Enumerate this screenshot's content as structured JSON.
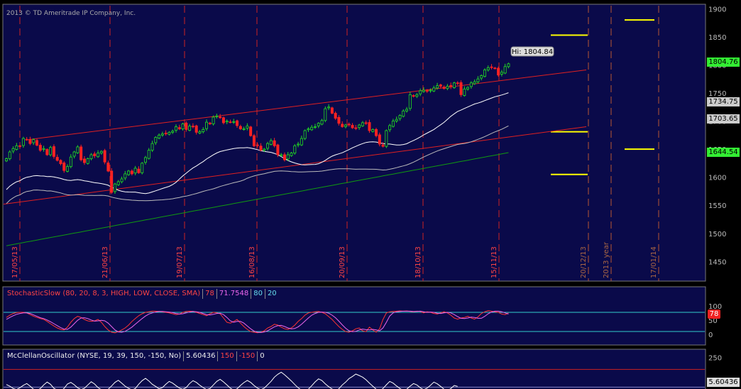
{
  "copyright": "2013 © TD Ameritrade IP Company, Inc.",
  "colors": {
    "panel_bg": "#0a0a4a",
    "up_candle": "#22dd22",
    "down_candle": "#ff2222",
    "channel": "#e02020",
    "ma_short": "#ffffff",
    "ma_mid": "#bbbbbb",
    "ma_long": "#119911",
    "yellow_levels": "#ffff00",
    "price_badge": "#33ee33",
    "stoch_k": "#ff3333",
    "stoch_d": "#ee66ee",
    "osc_line": "#ffffff"
  },
  "chart_data": [
    {
      "type": "candlestick",
      "title": "",
      "ylim": [
        1415,
        1908
      ],
      "y_ticks": [
        "1900",
        "1850",
        "1800",
        "1750",
        "1700",
        "1650",
        "1600",
        "1550",
        "1500",
        "1450"
      ],
      "x_date_labels": [
        "17/05/13",
        "21/06/13",
        "19/07/13",
        "16/08/13",
        "20/09/13",
        "18/10/13",
        "15/11/13",
        "20/12/13",
        "2013 year",
        "17/01/14"
      ],
      "hi_label": "Hi: 1804.84",
      "price_badges": [
        {
          "value": "1804.76",
          "y": 1804.76,
          "style": "green"
        },
        {
          "value": "1734.75",
          "y": 1734.75,
          "style": "gray"
        },
        {
          "value": "1703.65",
          "y": 1703.65,
          "style": "gray"
        },
        {
          "value": "1644.54",
          "y": 1644.54,
          "style": "green"
        }
      ],
      "closes": [
        1633,
        1645,
        1651,
        1656,
        1655,
        1669,
        1667,
        1660,
        1667,
        1657,
        1648,
        1651,
        1640,
        1653,
        1637,
        1630,
        1624,
        1612,
        1619,
        1636,
        1645,
        1654,
        1631,
        1626,
        1633,
        1640,
        1638,
        1643,
        1646,
        1627,
        1611,
        1573,
        1588,
        1592,
        1597,
        1606,
        1611,
        1606,
        1616,
        1608,
        1625,
        1635,
        1648,
        1660,
        1671,
        1675,
        1677,
        1678,
        1680,
        1682,
        1690,
        1686,
        1695,
        1685,
        1691,
        1690,
        1680,
        1681,
        1685,
        1698,
        1695,
        1707,
        1709,
        1706,
        1697,
        1700,
        1698,
        1699,
        1692,
        1686,
        1686,
        1691,
        1674,
        1656,
        1657,
        1648,
        1650,
        1660,
        1665,
        1656,
        1640,
        1640,
        1631,
        1640,
        1643,
        1656,
        1659,
        1669,
        1683,
        1686,
        1689,
        1690,
        1696,
        1701,
        1722,
        1725,
        1714,
        1705,
        1696,
        1690,
        1693,
        1694,
        1688,
        1687,
        1693,
        1697,
        1696,
        1683,
        1685,
        1674,
        1659,
        1655,
        1683,
        1692,
        1700,
        1703,
        1710,
        1718,
        1721,
        1747,
        1744,
        1747,
        1754,
        1755,
        1753,
        1755,
        1759,
        1763,
        1762,
        1758,
        1762,
        1761,
        1768,
        1767,
        1747,
        1757,
        1760,
        1768,
        1770,
        1775,
        1781,
        1791,
        1795,
        1796,
        1794,
        1782,
        1787,
        1797,
        1802
      ]
    },
    {
      "type": "line",
      "legend_items": [
        "StochasticSlow (80, 20, 8, 3, HIGH, LOW, CLOSE, SMA)",
        "78",
        "71.7548",
        "80",
        "20"
      ],
      "ylim": [
        0,
        100
      ],
      "y_ticks": [
        "100",
        "50",
        "0"
      ],
      "overbought": 80,
      "oversold": 20,
      "current_badge": "78",
      "current_value": 78,
      "series": [
        {
          "values": [
            62,
            70,
            76,
            79,
            80,
            80,
            78,
            72,
            66,
            62,
            58,
            55,
            48,
            40,
            32,
            25,
            20,
            18,
            28,
            45,
            58,
            66,
            62,
            55,
            50,
            48,
            50,
            55,
            45,
            30,
            18,
            10,
            8,
            12,
            18,
            25,
            35,
            48,
            58,
            68,
            75,
            80,
            82,
            84,
            84,
            83,
            82,
            80,
            78,
            75,
            72,
            74,
            80,
            83,
            84,
            83,
            80,
            76,
            72,
            68,
            75,
            80,
            78,
            75,
            60,
            45,
            42,
            48,
            55,
            42,
            30,
            20,
            12,
            10,
            8,
            10,
            15,
            25,
            30,
            38,
            35,
            28,
            22,
            20,
            25,
            35,
            48,
            58,
            70,
            78,
            80,
            82,
            83,
            80,
            75,
            65,
            55,
            42,
            30,
            20,
            12,
            10,
            15,
            22,
            25,
            15,
            12,
            28,
            18,
            10,
            22,
            55,
            78,
            82,
            83,
            84,
            85,
            84,
            85,
            83,
            82,
            84,
            83,
            78,
            82,
            80,
            76,
            74,
            78,
            82,
            78,
            70,
            60,
            56,
            60,
            62,
            66,
            60,
            56,
            64,
            76,
            82,
            86,
            84,
            82,
            80,
            74,
            72,
            78
          ]
        },
        {
          "values": [
            55,
            62,
            68,
            73,
            76,
            78,
            78,
            76,
            71,
            66,
            61,
            58,
            53,
            47,
            40,
            33,
            26,
            21,
            20,
            28,
            40,
            52,
            60,
            61,
            58,
            53,
            49,
            50,
            52,
            50,
            42,
            30,
            18,
            11,
            10,
            13,
            20,
            28,
            38,
            48,
            58,
            67,
            74,
            78,
            81,
            83,
            83,
            82,
            81,
            79,
            76,
            74,
            75,
            78,
            81,
            83,
            82,
            80,
            76,
            72,
            71,
            73,
            76,
            77,
            72,
            62,
            50,
            45,
            48,
            48,
            42,
            32,
            22,
            14,
            10,
            9,
            11,
            15,
            22,
            29,
            33,
            34,
            30,
            25,
            22,
            23,
            29,
            38,
            49,
            60,
            70,
            76,
            80,
            81,
            80,
            77,
            70,
            61,
            49,
            36,
            24,
            15,
            12,
            13,
            18,
            21,
            19,
            18,
            20,
            18,
            15,
            25,
            45,
            67,
            78,
            82,
            83,
            84,
            84,
            84,
            83,
            83,
            84,
            82,
            80,
            81,
            80,
            77,
            76,
            78,
            80,
            78,
            72,
            65,
            59,
            58,
            60,
            63,
            62,
            59,
            59,
            66,
            75,
            81,
            84,
            84,
            82,
            78,
            74
          ]
        }
      ]
    },
    {
      "type": "line",
      "legend_items": [
        "McClellanOscillator (NYSE, 19, 39, 150, -150, No)",
        "5.60436",
        "150",
        "-150",
        "0"
      ],
      "ylim": [
        -40,
        320
      ],
      "y_ticks": [
        "250"
      ],
      "upper_level": 150,
      "zero_level": 0,
      "current_badge": "5.60436",
      "current_value": 5.60436,
      "series": [
        {
          "values": [
            22,
            8,
            -12,
            -20,
            -5,
            15,
            30,
            8,
            -18,
            -28,
            -12,
            18,
            42,
            24,
            -10,
            -25,
            -35,
            -10,
            26,
            40,
            20,
            -6,
            -20,
            -10,
            18,
            45,
            26,
            -4,
            -22,
            -34,
            -18,
            10,
            40,
            58,
            34,
            8,
            -10,
            -24,
            -12,
            24,
            54,
            74,
            52,
            24,
            6,
            -14,
            -4,
            24,
            48,
            34,
            12,
            -8,
            -18,
            -4,
            30,
            54,
            40,
            16,
            -4,
            -20,
            -12,
            18,
            48,
            66,
            44,
            18,
            -8,
            -26,
            -14,
            14,
            38,
            56,
            40,
            14,
            -8,
            -22,
            -8,
            20,
            48,
            84,
            108,
            126,
            104,
            78,
            52,
            22,
            -6,
            -26,
            -38,
            -18,
            12,
            44,
            70,
            56,
            28,
            4,
            -16,
            -30,
            -14,
            18,
            42,
            72,
            90,
            110,
            98,
            84,
            62,
            34,
            8,
            -18,
            -32,
            -12,
            20,
            48,
            34,
            10,
            -12,
            -28,
            -18,
            8,
            30,
            18,
            -6,
            -22,
            -8,
            16,
            42,
            28,
            6,
            -18,
            -30,
            -12,
            14,
            5.6
          ]
        }
      ]
    }
  ]
}
